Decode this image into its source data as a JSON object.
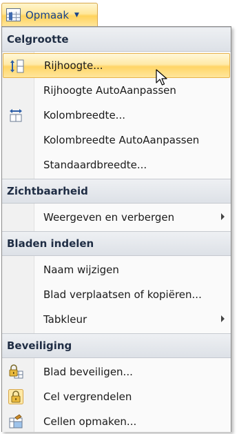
{
  "ribbon_button": {
    "label": "Opmaak",
    "icon": "format-cells-grid-icon"
  },
  "menu": {
    "sections": [
      {
        "header": "Celgrootte",
        "items": [
          {
            "label": "Rijhoogte...",
            "icon": "row-height-icon",
            "highlighted": true
          },
          {
            "label": "Rijhoogte AutoAanpassen",
            "icon": ""
          },
          {
            "label": "Kolombreedte...",
            "icon": "column-width-icon"
          },
          {
            "label": "Kolombreedte AutoAanpassen",
            "icon": ""
          },
          {
            "label": "Standaardbreedte...",
            "icon": ""
          }
        ]
      },
      {
        "header": "Zichtbaarheid",
        "items": [
          {
            "label": "Weergeven en verbergen",
            "icon": "",
            "submenu": true
          }
        ]
      },
      {
        "header": "Bladen indelen",
        "items": [
          {
            "label": "Naam wijzigen",
            "icon": ""
          },
          {
            "label": "Blad verplaatsen of kopiëren...",
            "icon": ""
          },
          {
            "label": "Tabkleur",
            "icon": "",
            "submenu": true
          }
        ]
      },
      {
        "header": "Beveiliging",
        "items": [
          {
            "label": "Blad beveiligen...",
            "icon": "protect-sheet-icon"
          },
          {
            "label": "Cel vergrendelen",
            "icon": "lock-cell-icon"
          },
          {
            "label": "Cellen opmaken...",
            "icon": "format-cells-icon"
          }
        ]
      }
    ]
  },
  "colors": {
    "highlight": "#ffd567",
    "header_bg": "#dde1e7",
    "ribbon_text": "#15428b"
  }
}
